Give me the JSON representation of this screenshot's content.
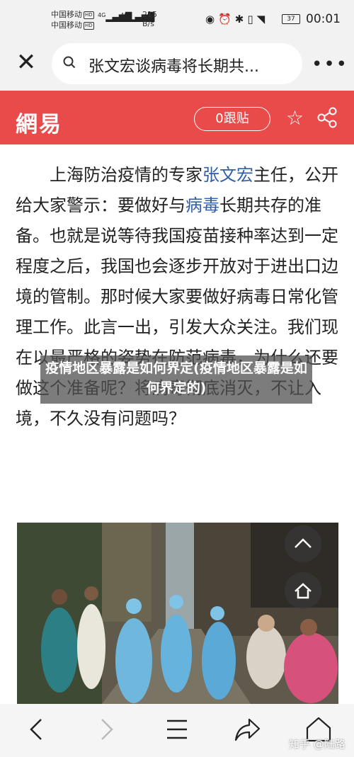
{
  "status_bar": {
    "carrier_1": "中国移动",
    "carrier_2": "中国移动",
    "hd_badge": "HD",
    "signal_1": "4G",
    "signal_2": "4G",
    "speed_value": "215",
    "speed_unit": "B/s",
    "battery": "37",
    "time": "00:01"
  },
  "search": {
    "query": "张文宏谈病毒将长期共..."
  },
  "header": {
    "logo": "網易",
    "follow_label": "0跟贴"
  },
  "article": {
    "p1_a": "上海防治疫情的专家",
    "p1_link_1": "张文宏",
    "p1_b": "主任，公开给大家警示：要做好与",
    "p1_link_2": "病毒",
    "p1_c": "长期共存的准备。也就是说等待我国疫苗接种率达到一定程度之后，我国也会逐步开放对于进出口边境的管制。那时候大家要做好病毒日常化管理工作。此言一出，引发大众关注。我们现在以最严格的姿势在防范病毒，为什么还要做这个准备呢？将病毒彻底消灭，不让入境，不久没有问题吗？"
  },
  "overlay": {
    "title": "疫情地区暴露是如何界定(疫情地区暴露是如何界定的)"
  },
  "watermark": "知乎 @陆路",
  "colors": {
    "brand_red": "#e94a4a",
    "link_blue": "#2f5ea6"
  }
}
